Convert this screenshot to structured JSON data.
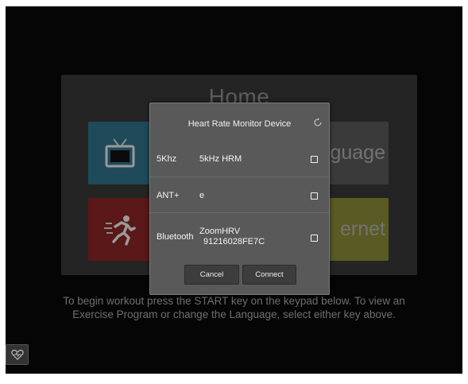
{
  "home": {
    "title": "Home",
    "tiles": {
      "language_label": "guage",
      "internet_label": "ernet"
    }
  },
  "instructions": {
    "line1": "To begin workout press the START key on the keypad below. To view an",
    "line2": "Exercise Program or change the Language, select either key above."
  },
  "dialog": {
    "title": "Heart Rate Monitor Device",
    "rows": [
      {
        "type": "5Khz",
        "name": "5kHz HRM",
        "name2": ""
      },
      {
        "type": "ANT+",
        "name": "e",
        "name2": ""
      },
      {
        "type": "Bluetooth",
        "name": "ZoomHRV",
        "name2": "91216028FE7C"
      }
    ],
    "cancel_label": "Cancel",
    "connect_label": "Connect"
  },
  "colors": {
    "tv_tile": "#1f4a5a",
    "workout_tile": "#5a1818",
    "internet_tile": "#5a5a24",
    "dialog_bg": "#595959"
  },
  "icons": [
    "tv-icon",
    "runner-icon",
    "refresh-icon",
    "heart-monitor-icon"
  ]
}
